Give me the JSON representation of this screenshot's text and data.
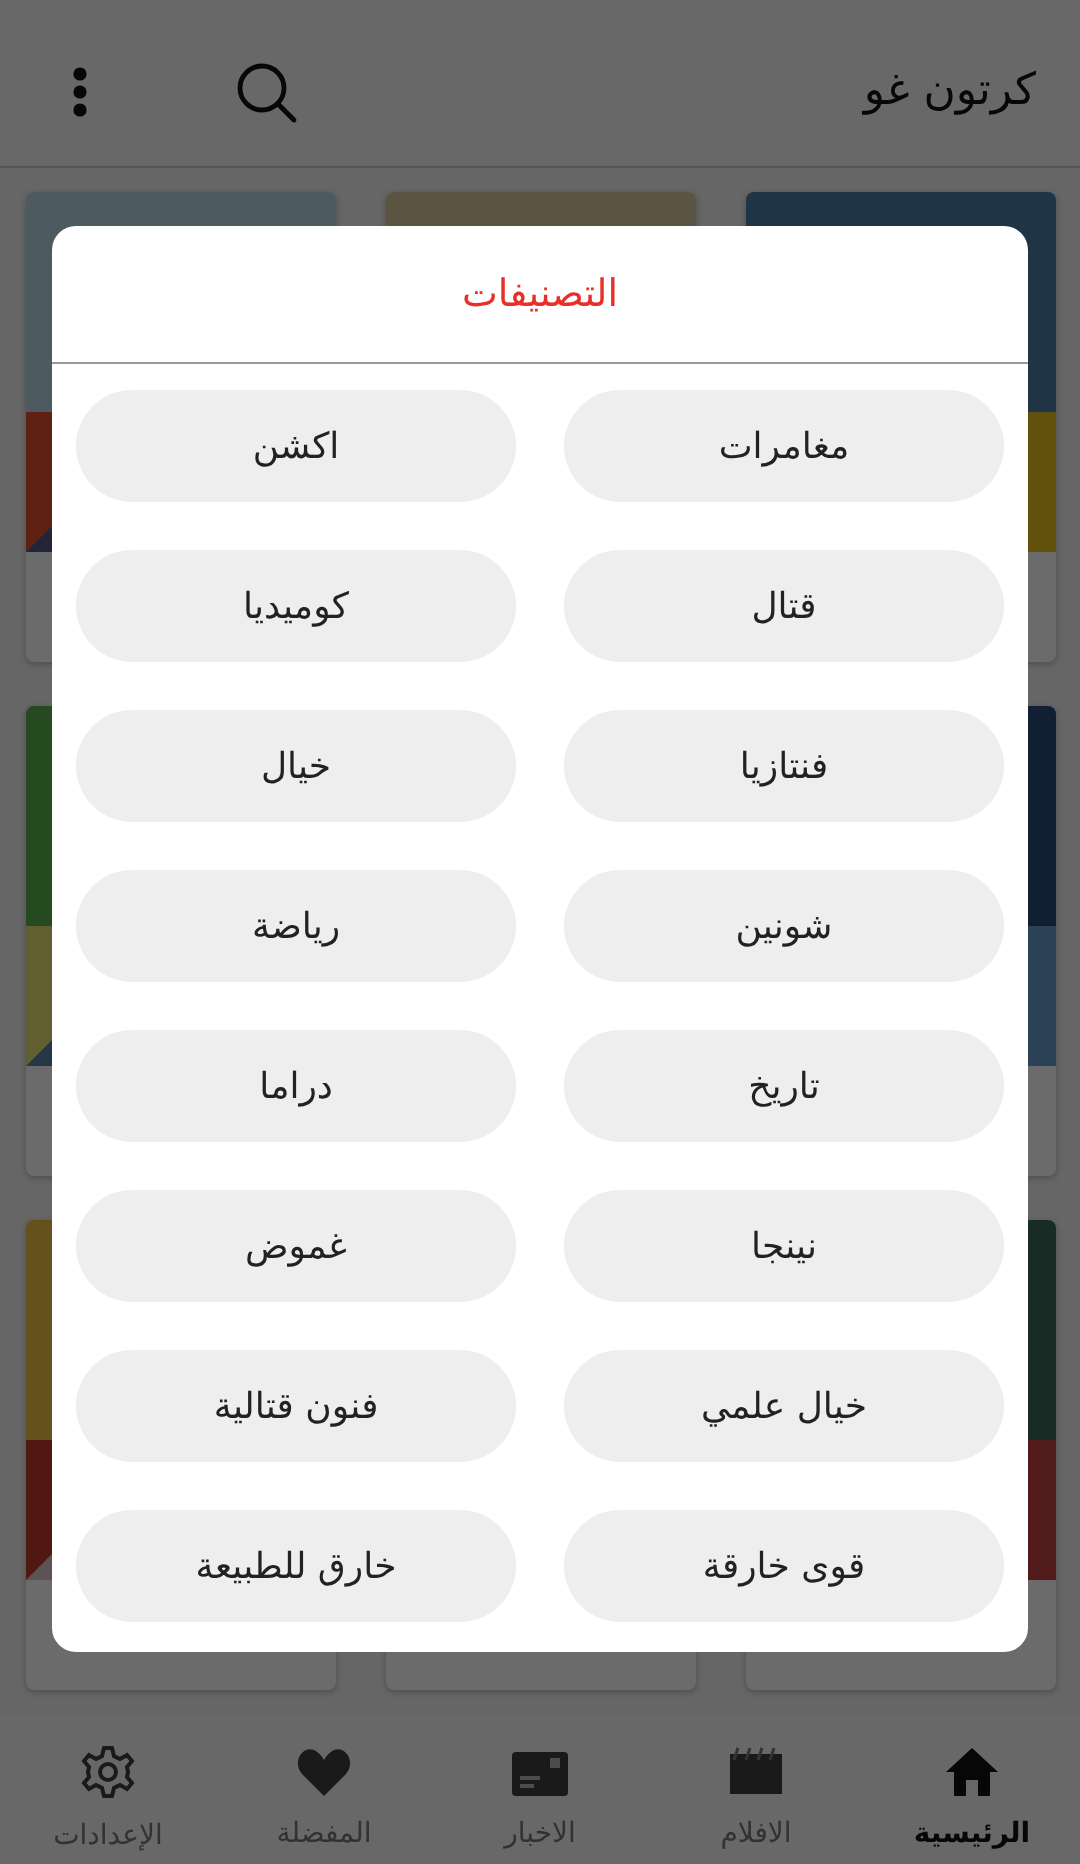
{
  "app_bar": {
    "title": "كرتون غو"
  },
  "dialog": {
    "title": "التصنيفات",
    "categories": [
      "مغامرات",
      "اكشن",
      "قتال",
      "كوميديا",
      "فنتازيا",
      "خيال",
      "شونين",
      "رياضة",
      "تاريخ",
      "دراما",
      "نينجا",
      "غموض",
      "خيال علمي",
      "فنون قتالية",
      "قوى خارقة",
      "خارق للطبيعة"
    ]
  },
  "bottom_nav": [
    {
      "label": "الرئيسية",
      "kind": "home",
      "selected": true
    },
    {
      "label": "الافلام",
      "kind": "movies",
      "selected": false
    },
    {
      "label": "الاخبار",
      "kind": "news",
      "selected": false
    },
    {
      "label": "المفضلة",
      "kind": "favorites",
      "selected": false
    },
    {
      "label": "الإعدادات",
      "kind": "settings",
      "selected": false
    }
  ]
}
